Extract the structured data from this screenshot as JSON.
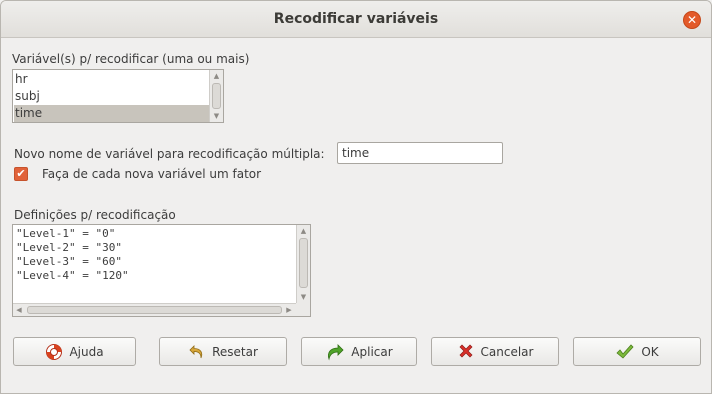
{
  "window": {
    "title": "Recodificar variáveis",
    "close_glyph": "✕"
  },
  "variables": {
    "label": "Variável(s) p/ recodificar (uma ou mais)",
    "items": [
      "hr",
      "subj",
      "time"
    ],
    "selected": "time"
  },
  "new_name": {
    "label": "Novo nome de variável para recodificação múltipla:",
    "value": "time"
  },
  "factor": {
    "label": "Faça de cada nova variável um fator",
    "checked": true
  },
  "definitions": {
    "label": "Definições p/ recodificação",
    "lines": [
      "\"Level-1\" = \"0\"",
      "\"Level-2\" = \"30\"",
      "\"Level-3\" = \"60\"",
      "\"Level-4\" = \"120\""
    ]
  },
  "buttons": {
    "help": {
      "label": "Ajuda",
      "icon": "lifebuoy-icon"
    },
    "reset": {
      "label": "Resetar",
      "icon": "undo-arrow-icon"
    },
    "apply": {
      "label": "Aplicar",
      "icon": "redo-arrow-icon"
    },
    "cancel": {
      "label": "Cancelar",
      "icon": "red-x-icon"
    },
    "ok": {
      "label": "OK",
      "icon": "checkmark-icon"
    }
  },
  "colors": {
    "accent": "#e1623a",
    "close": "#e35a2a",
    "selection": "#c8c4bc"
  }
}
